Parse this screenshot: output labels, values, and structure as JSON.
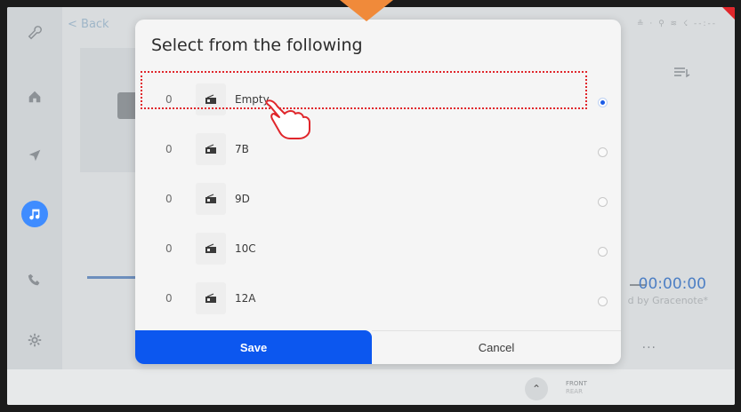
{
  "header": {
    "back_label": "< Back",
    "status_text": "≗ · ⚲ ≋ ☇  --:--"
  },
  "rail": {
    "items": [
      {
        "icon": "wrench-icon"
      },
      {
        "icon": "home-icon"
      },
      {
        "icon": "navigation-icon"
      },
      {
        "icon": "music-icon",
        "active": true
      },
      {
        "icon": "phone-icon"
      },
      {
        "icon": "settings-icon"
      }
    ]
  },
  "player": {
    "time": "00:00:00",
    "attribution": "d by Gracenote*",
    "more_label": "..."
  },
  "zone": {
    "front": "FRONT",
    "rear": "REAR"
  },
  "modal": {
    "title": "Select from the following",
    "rows": [
      {
        "num": "0",
        "icon": "radio-icon",
        "label": "Empty",
        "selected": true
      },
      {
        "num": "0",
        "icon": "radio-icon",
        "label": "7B",
        "selected": false
      },
      {
        "num": "0",
        "icon": "radio-icon",
        "label": "9D",
        "selected": false
      },
      {
        "num": "0",
        "icon": "radio-icon",
        "label": "10C",
        "selected": false
      },
      {
        "num": "0",
        "icon": "radio-icon",
        "label": "12A",
        "selected": false
      }
    ],
    "save_label": "Save",
    "cancel_label": "Cancel"
  },
  "colors": {
    "accent": "#0c57ef",
    "highlight": "#e0262b",
    "callout": "#f08a3a"
  }
}
